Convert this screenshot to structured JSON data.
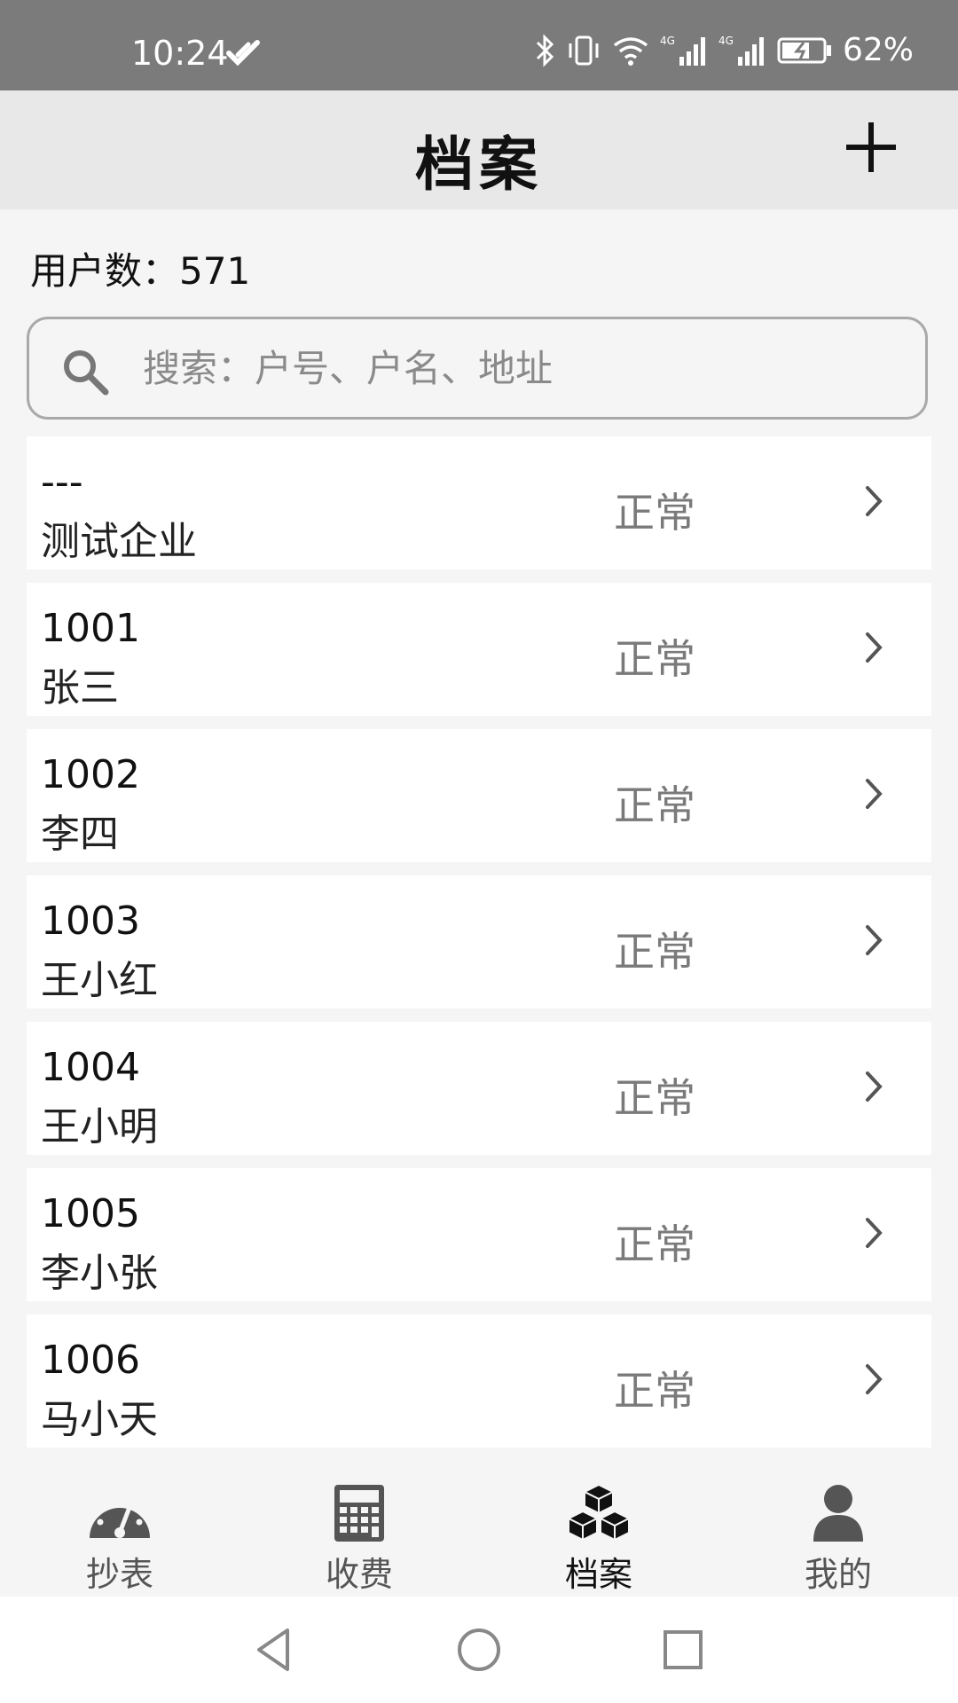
{
  "status_bar": {
    "time": "10:24",
    "battery_percent": "62%"
  },
  "header": {
    "title": "档案"
  },
  "summary": {
    "user_count_label": "用户数：",
    "user_count_value": "571"
  },
  "search": {
    "placeholder": "搜索：户号、户名、地址"
  },
  "records": [
    {
      "id": "---",
      "name": "测试企业",
      "status": "正常"
    },
    {
      "id": "1001",
      "name": "张三",
      "status": "正常"
    },
    {
      "id": "1002",
      "name": "李四",
      "status": "正常"
    },
    {
      "id": "1003",
      "name": "王小红",
      "status": "正常"
    },
    {
      "id": "1004",
      "name": "王小明",
      "status": "正常"
    },
    {
      "id": "1005",
      "name": "李小张",
      "status": "正常"
    },
    {
      "id": "1006",
      "name": "马小天",
      "status": "正常"
    }
  ],
  "bottom_nav": [
    {
      "label": "抄表",
      "icon": "gauge-icon"
    },
    {
      "label": "收费",
      "icon": "calculator-icon"
    },
    {
      "label": "档案",
      "icon": "boxes-icon",
      "active": true
    },
    {
      "label": "我的",
      "icon": "user-icon"
    }
  ],
  "colors": {
    "status_bar": "#7b7b7b",
    "header_bg": "#e8e8e8",
    "page_bg": "#f5f5f5",
    "status_text": "#7a7a7a"
  }
}
